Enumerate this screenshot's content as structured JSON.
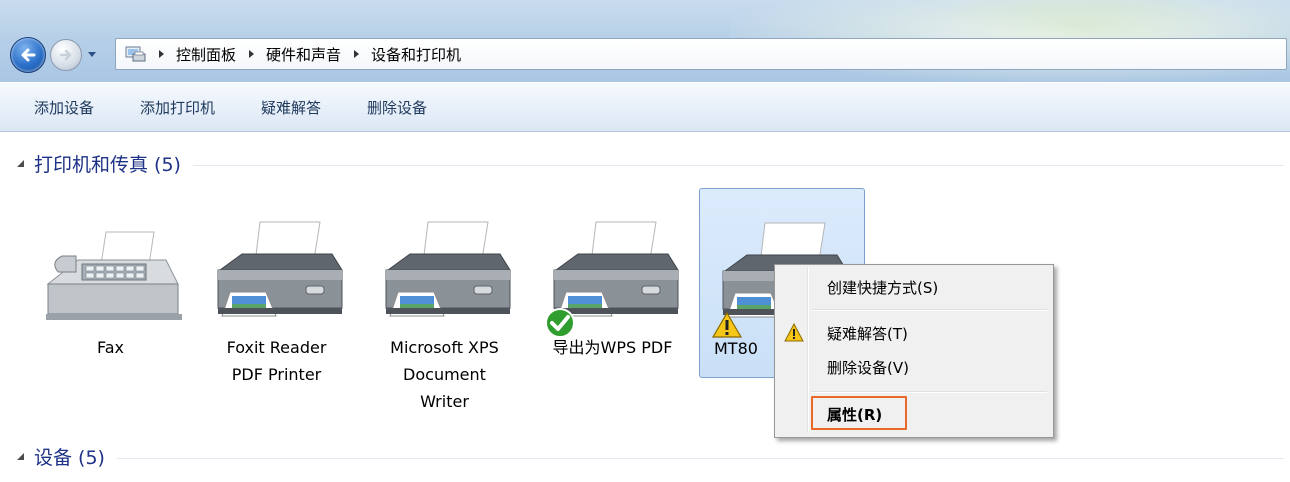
{
  "address": {
    "crumbs": [
      "控制面板",
      "硬件和声音",
      "设备和打印机"
    ]
  },
  "toolbar": {
    "commands": [
      "添加设备",
      "添加打印机",
      "疑难解答",
      "删除设备"
    ]
  },
  "groups": {
    "printers": {
      "title": "打印机和传真 (5)"
    },
    "devices": {
      "title": "设备 (5)"
    }
  },
  "printers": [
    {
      "label": "Fax",
      "icon": "fax-icon"
    },
    {
      "label": "Foxit Reader\nPDF Printer",
      "icon": "printer-icon"
    },
    {
      "label": "Microsoft XPS\nDocument\nWriter",
      "icon": "printer-icon"
    },
    {
      "label": "导出为WPS PDF",
      "icon": "printer-icon",
      "badge": "default-check-icon"
    },
    {
      "label": "MT80",
      "icon": "printer-icon",
      "badge": "warning-icon",
      "selected": true
    }
  ],
  "context_menu": {
    "create_shortcut": "创建快捷方式(S)",
    "troubleshoot": "疑难解答(T)",
    "remove_device": "删除设备(V)",
    "properties": "属性(R)"
  },
  "colors": {
    "highlight_box": "#e8692a",
    "group_title": "#1e3287",
    "selection": "#c9e0f7"
  }
}
